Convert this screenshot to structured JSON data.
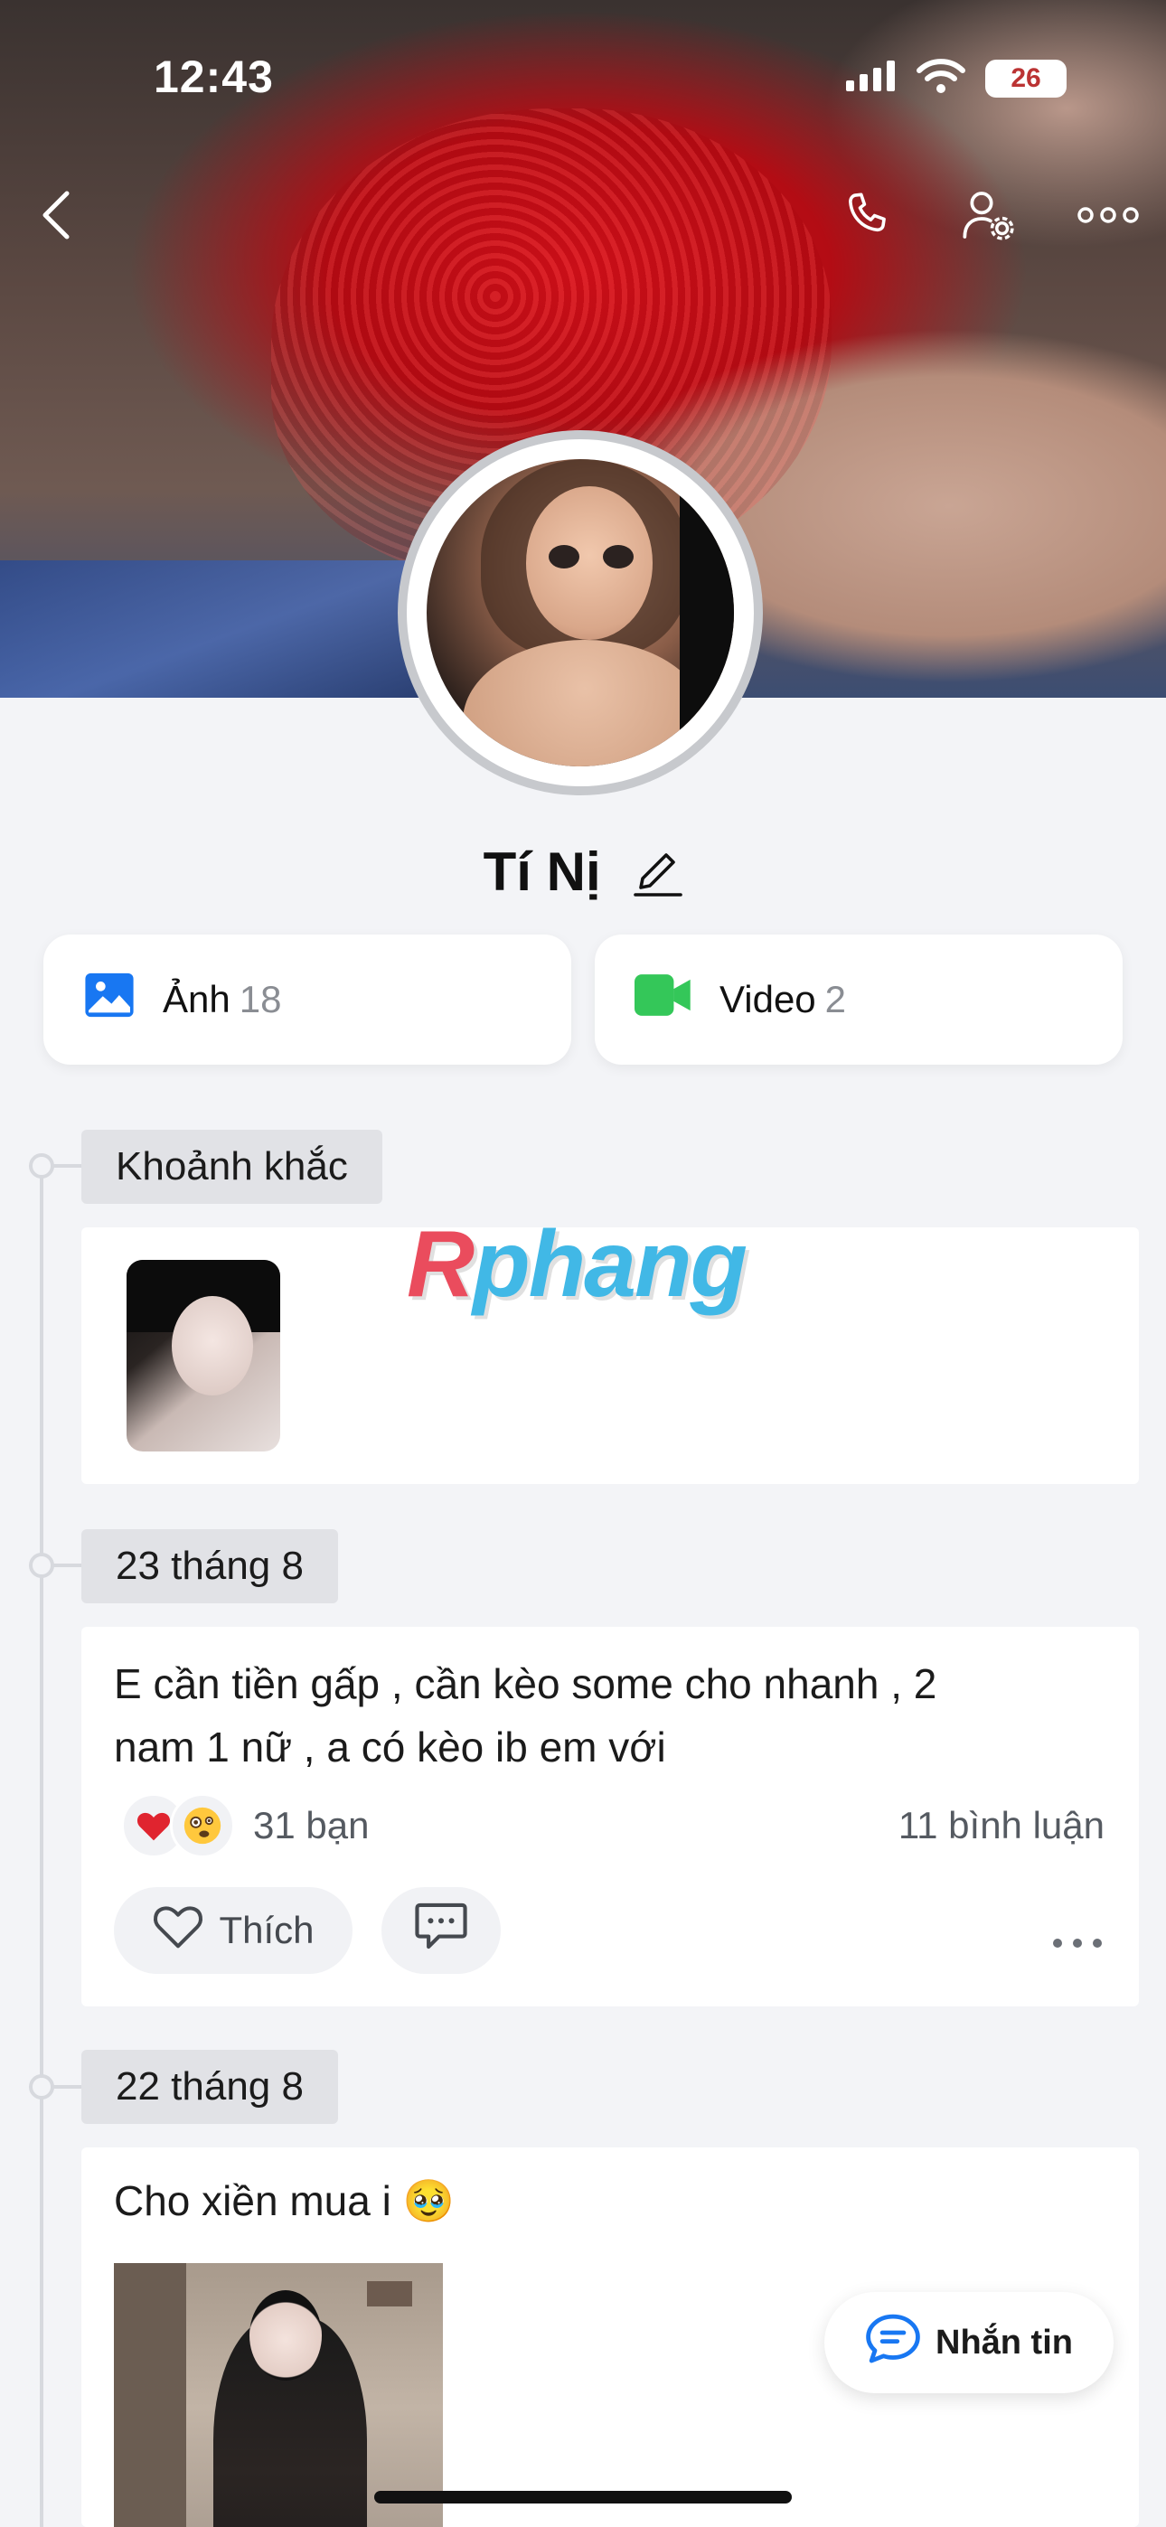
{
  "status_bar": {
    "time": "12:43",
    "battery": "26"
  },
  "profile": {
    "name": "Tí Nị"
  },
  "media": [
    {
      "label": "Ảnh",
      "count": "18"
    },
    {
      "label": "Video",
      "count": "2"
    }
  ],
  "timeline": {
    "moments_label": "Khoảnh khắc",
    "posts": [
      {
        "date": "23 tháng 8",
        "text_line1": "E cần tiền gấp , cần kèo some cho nhanh , 2",
        "text_line2": "nam 1 nữ , a có kèo ib em với",
        "reactions": "31 bạn",
        "comments": "11 bình luận",
        "like_label": "Thích"
      },
      {
        "date": "22 tháng 8",
        "text": "Cho xiền mua i 🥹"
      }
    ]
  },
  "watermark": {
    "r": "R",
    "rest": "phang"
  },
  "fab": {
    "label": "Nhắn tin"
  },
  "colors": {
    "accent_blue": "#1877f2",
    "video_green": "#34c759",
    "heart_red": "#e0242f"
  },
  "icons": [
    "back-icon",
    "phone-icon",
    "user-settings-icon",
    "more-icon",
    "edit-icon",
    "photo-icon",
    "video-icon",
    "heart-icon",
    "comment-icon",
    "chat-icon"
  ]
}
